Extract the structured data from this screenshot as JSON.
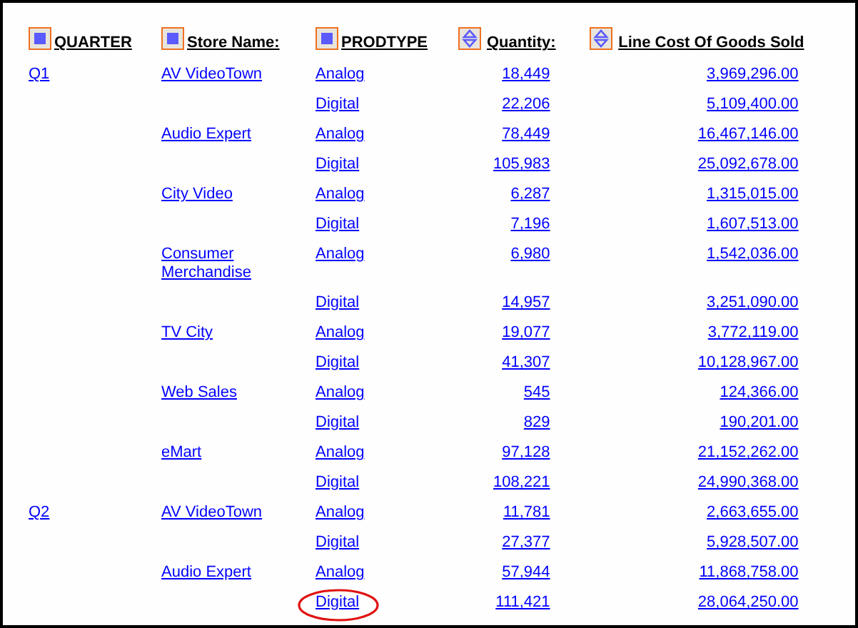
{
  "table": {
    "columns": [
      {
        "label": "QUARTER",
        "kind": "square"
      },
      {
        "label": "Store Name:",
        "kind": "square"
      },
      {
        "label": "PRODTYPE",
        "kind": "square"
      },
      {
        "label": "Quantity:",
        "kind": "sort"
      },
      {
        "label": "Line Cost Of Goods Sold",
        "kind": "sort"
      }
    ],
    "rows": [
      {
        "cells": [
          "Q1",
          "AV VideoTown",
          "Analog",
          "18,449",
          "3,969,296.00"
        ],
        "circled": false
      },
      {
        "cells": [
          "",
          "",
          "Digital",
          "22,206",
          "5,109,400.00"
        ],
        "circled": false
      },
      {
        "cells": [
          "",
          "Audio Expert",
          "Analog",
          "78,449",
          "16,467,146.00"
        ],
        "circled": false
      },
      {
        "cells": [
          "",
          "",
          "Digital",
          "105,983",
          "25,092,678.00"
        ],
        "circled": false
      },
      {
        "cells": [
          "",
          "City Video",
          "Analog",
          "6,287",
          "1,315,015.00"
        ],
        "circled": false
      },
      {
        "cells": [
          "",
          "",
          "Digital",
          "7,196",
          "1,607,513.00"
        ],
        "circled": false
      },
      {
        "cells": [
          "",
          "Consumer Merchandise",
          "Analog",
          "6,980",
          "1,542,036.00"
        ],
        "circled": false
      },
      {
        "cells": [
          "",
          "",
          "Digital",
          "14,957",
          "3,251,090.00"
        ],
        "circled": false
      },
      {
        "cells": [
          "",
          "TV City",
          "Analog",
          "19,077",
          "3,772,119.00"
        ],
        "circled": false
      },
      {
        "cells": [
          "",
          "",
          "Digital",
          "41,307",
          "10,128,967.00"
        ],
        "circled": false
      },
      {
        "cells": [
          "",
          "Web Sales",
          "Analog",
          "545",
          "124,366.00"
        ],
        "circled": false
      },
      {
        "cells": [
          "",
          "",
          "Digital",
          "829",
          "190,201.00"
        ],
        "circled": false
      },
      {
        "cells": [
          "",
          "eMart",
          "Analog",
          "97,128",
          "21,152,262.00"
        ],
        "circled": false
      },
      {
        "cells": [
          "",
          "",
          "Digital",
          "108,221",
          "24,990,368.00"
        ],
        "circled": false
      },
      {
        "cells": [
          "Q2",
          "AV VideoTown",
          "Analog",
          "11,781",
          "2,663,655.00"
        ],
        "circled": false
      },
      {
        "cells": [
          "",
          "",
          "Digital",
          "27,377",
          "5,928,507.00"
        ],
        "circled": false
      },
      {
        "cells": [
          "",
          "Audio Expert",
          "Analog",
          "57,944",
          "11,868,758.00"
        ],
        "circled": false
      },
      {
        "cells": [
          "",
          "",
          "Digital",
          "111,421",
          "28,064,250.00"
        ],
        "circled": true
      }
    ]
  }
}
